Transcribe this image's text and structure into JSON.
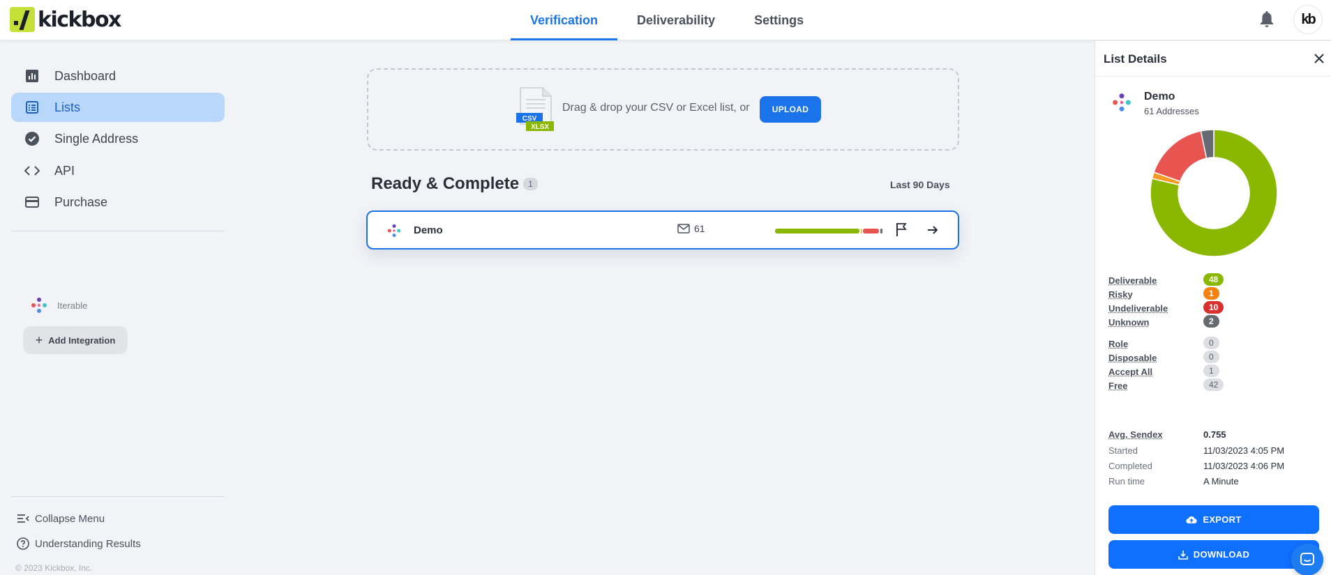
{
  "brand": {
    "logo_text": "kickbox"
  },
  "nav": {
    "tabs": [
      {
        "label": "Verification",
        "active": true
      },
      {
        "label": "Deliverability",
        "active": false
      },
      {
        "label": "Settings",
        "active": false
      }
    ],
    "avatar_text": "kb"
  },
  "sidebar": {
    "items": [
      {
        "label": "Dashboard",
        "icon": "bar-chart-icon"
      },
      {
        "label": "Lists",
        "icon": "list-icon",
        "active": true
      },
      {
        "label": "Single Address",
        "icon": "check-circle-icon"
      },
      {
        "label": "API",
        "icon": "code-icon"
      },
      {
        "label": "Purchase",
        "icon": "credit-card-icon"
      }
    ],
    "integration_label": "Iterable",
    "add_integration_label": "Add Integration",
    "collapse_label": "Collapse Menu",
    "understanding_label": "Understanding Results",
    "copyright": "© 2023 Kickbox, Inc."
  },
  "upload": {
    "text": "Drag & drop your CSV or Excel list, or",
    "button_label": "UPLOAD",
    "file_badge_top": "CSV",
    "file_badge_bottom": "XLSX"
  },
  "lists": {
    "section_title": "Ready & Complete",
    "count": "1",
    "period_label": "Last 90 Days",
    "rows": [
      {
        "name": "Demo",
        "emails": "61",
        "deliverable": 48,
        "risky": 1,
        "undeliverable": 10,
        "unknown": 2
      }
    ]
  },
  "details": {
    "title": "List Details",
    "list_name": "Demo",
    "address_count": "61 Addresses",
    "status": [
      {
        "label": "Deliverable",
        "value": "48",
        "color": "#8ab800"
      },
      {
        "label": "Risky",
        "value": "1",
        "color": "#f59a23"
      },
      {
        "label": "Undeliverable",
        "value": "10",
        "color": "#e8544f"
      },
      {
        "label": "Unknown",
        "value": "2",
        "color": "#666a70"
      }
    ],
    "attributes": [
      {
        "label": "Role",
        "value": "0"
      },
      {
        "label": "Disposable",
        "value": "0"
      },
      {
        "label": "Accept All",
        "value": "1"
      },
      {
        "label": "Free",
        "value": "42"
      }
    ],
    "info": [
      {
        "label": "Avg. Sendex",
        "value": "0.755"
      },
      {
        "label": "Started",
        "value": "11/03/2023 4:05 PM"
      },
      {
        "label": "Completed",
        "value": "11/03/2023 4:06 PM"
      },
      {
        "label": "Run time",
        "value": "A Minute"
      }
    ],
    "export_label": "EXPORT",
    "download_label": "DOWNLOAD"
  },
  "colors": {
    "accent": "#1a73e8",
    "deliverable": "#8ab800",
    "risky": "#f59a23",
    "undeliverable": "#e8544f",
    "unknown": "#666a70"
  }
}
